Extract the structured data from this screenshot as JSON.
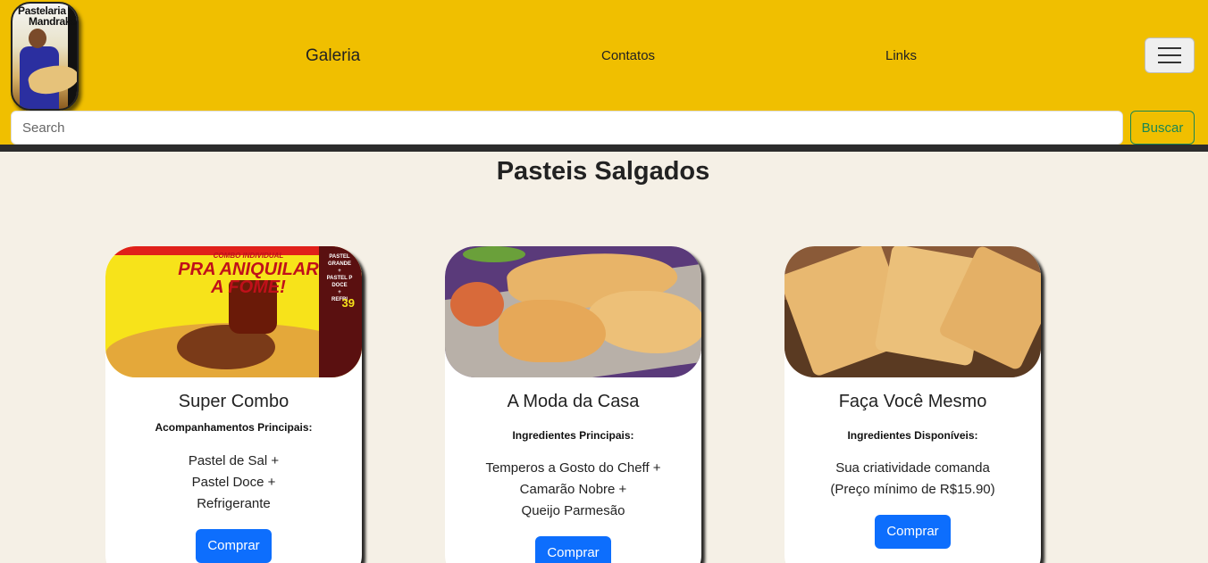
{
  "header": {
    "logo_line1": "Pastelaria",
    "logo_line2": "Mandrake",
    "nav": {
      "galeria": "Galeria",
      "contatos": "Contatos",
      "links": "Links"
    },
    "search": {
      "placeholder": "Search",
      "button": "Buscar"
    }
  },
  "main": {
    "title": "Pasteis Salgados",
    "cards": [
      {
        "title": "Super Combo",
        "subtitle": "Acompanhamentos Principais:",
        "lines": [
          "Pastel de Sal +",
          "Pastel Doce +",
          "Refrigerante"
        ],
        "button": "Comprar",
        "image_text": {
          "promo_small": "COMBO INDIVIDUAL",
          "promo_line1": "PRA ANIQUILAR",
          "promo_line2": "A FOME!",
          "side1": "PASTEL GRANDE",
          "side2": "+",
          "side3": "PASTEL P DOCE",
          "side4": "+",
          "side5": "REFRI",
          "price": "39"
        }
      },
      {
        "title": "A Moda da Casa",
        "subtitle": "Ingredientes Principais:",
        "lines": [
          "Temperos a Gosto do Cheff +",
          "Camarão Nobre +",
          "Queijo Parmesão"
        ],
        "button": "Comprar"
      },
      {
        "title": "Faça Você Mesmo",
        "subtitle": "Ingredientes Disponíveis:",
        "lines": [
          "Sua criatividade comanda",
          "(Preço mínimo de R$15.90)"
        ],
        "button": "Comprar"
      }
    ]
  },
  "colors": {
    "header_bg": "#f0bf00",
    "page_bg": "#f5f0e6",
    "primary_button": "#0d6efd",
    "search_button": "#198754"
  }
}
